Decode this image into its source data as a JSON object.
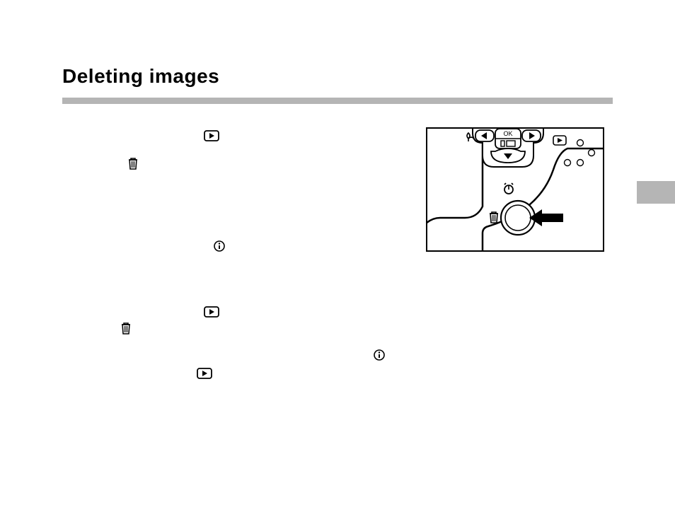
{
  "title": "Deleting images",
  "icons": {
    "play": "playback-icon",
    "trash": "trash-icon",
    "info": "info-icon",
    "ok_label": "OK"
  }
}
